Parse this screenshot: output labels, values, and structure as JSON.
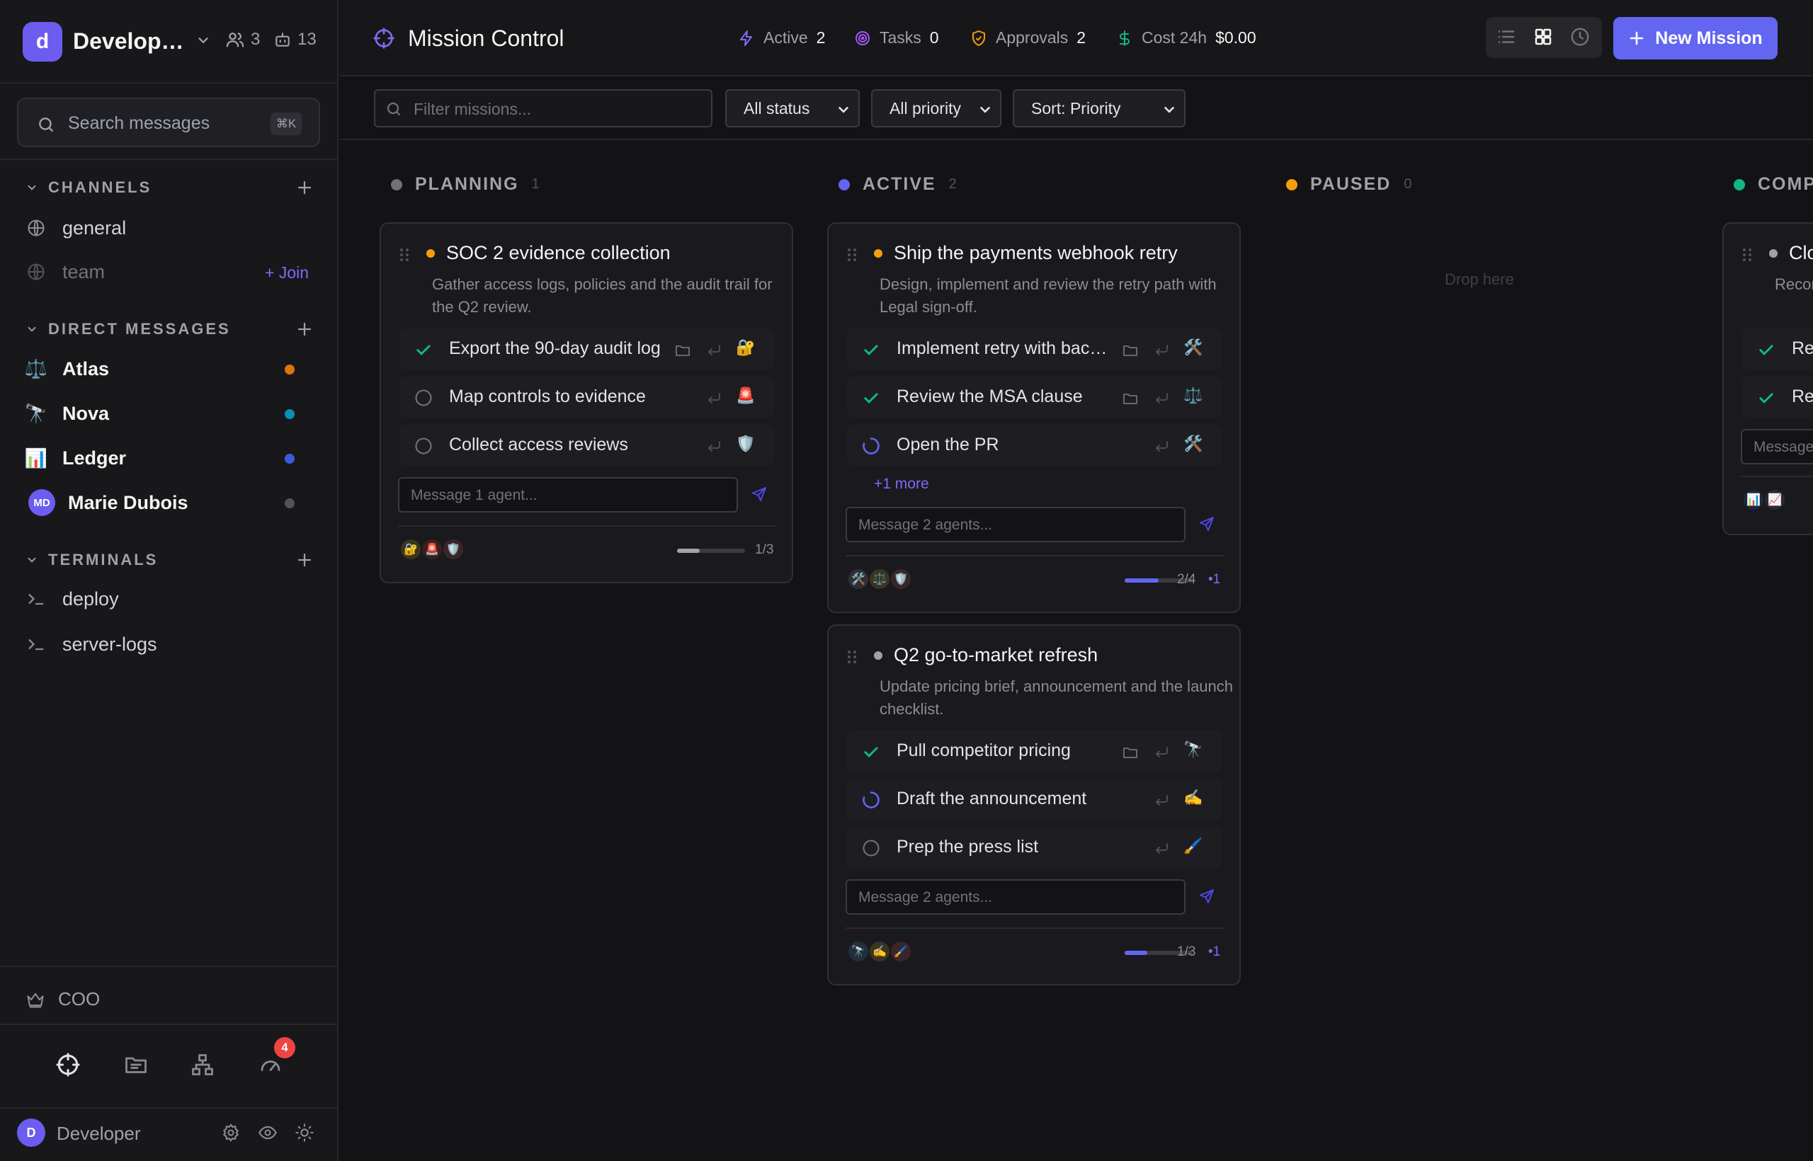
{
  "workspace": {
    "initial": "d",
    "name": "Development",
    "members": "3",
    "agents": "13"
  },
  "search": {
    "placeholder": "Search messages",
    "shortcut": "⌘K"
  },
  "channels": {
    "title": "CHANNELS",
    "items": [
      {
        "label": "general",
        "joined": true
      },
      {
        "label": "team",
        "joined": false,
        "join_label": "+ Join"
      }
    ]
  },
  "direct_messages": {
    "title": "DIRECT MESSAGES",
    "items": [
      {
        "label": "Atlas",
        "icon": "⚖️",
        "status_color": "#d97706"
      },
      {
        "label": "Nova",
        "icon": "🔭",
        "status_color": "#0891b2"
      },
      {
        "label": "Ledger",
        "icon": "📊",
        "status_color": "#3b5bdb"
      },
      {
        "label": "Marie Dubois",
        "initials": "MD",
        "status_color": "#52525b"
      }
    ]
  },
  "terminals": {
    "title": "TERMINALS",
    "items": [
      {
        "label": "deploy"
      },
      {
        "label": "server-logs"
      }
    ]
  },
  "coo": {
    "label": "COO"
  },
  "bottom_tabs": {
    "notifications_count": "4"
  },
  "user": {
    "initial": "D",
    "name": "Developer"
  },
  "header": {
    "title": "Mission Control",
    "stats": [
      {
        "label": "Active",
        "value": "2"
      },
      {
        "label": "Tasks",
        "value": "0"
      },
      {
        "label": "Approvals",
        "value": "2"
      },
      {
        "label": "Cost 24h",
        "value": "$0.00"
      }
    ],
    "new_mission_label": "New Mission"
  },
  "filters": {
    "search_placeholder": "Filter missions...",
    "status": "All status",
    "priority": "All priority",
    "sort": "Sort: Priority"
  },
  "columns": [
    {
      "name": "PLANNING",
      "count": "1",
      "color": "#71717a"
    },
    {
      "name": "ACTIVE",
      "count": "2",
      "color": "#6366f1"
    },
    {
      "name": "PAUSED",
      "count": "0",
      "color": "#f59e0b",
      "empty_label": "Drop here"
    },
    {
      "name": "COMPLETED",
      "count": "",
      "color": "#10b981"
    }
  ],
  "cards": [
    {
      "title": "SOC 2 evidence collection",
      "priority_color": "#f59e0b",
      "description": "Gather access logs, policies and the audit trail for the Q2 review.",
      "tasks": [
        {
          "label": "Export the 90-day audit log",
          "status": "done",
          "agent": "🔐"
        },
        {
          "label": "Map controls to evidence",
          "status": "todo",
          "agent": "🚨"
        },
        {
          "label": "Collect access reviews",
          "status": "todo",
          "agent": "🛡️"
        }
      ],
      "message_placeholder": "Message 1 agent...",
      "agents": [
        "🔐",
        "🚨",
        "🛡️"
      ],
      "progress": 0.33,
      "progress_label": "1/3"
    },
    {
      "title": "Ship the payments webhook retry",
      "priority_color": "#f59e0b",
      "description": "Design, implement and review the retry path with Legal sign-off.",
      "tasks": [
        {
          "label": "Implement retry with backoff",
          "status": "done",
          "agent": "🛠️"
        },
        {
          "label": "Review the MSA clause",
          "status": "done",
          "agent": "⚖️"
        },
        {
          "label": "Open the PR",
          "status": "running",
          "agent": "🛠️"
        }
      ],
      "more_label": "+1 more",
      "message_placeholder": "Message 2 agents...",
      "agents": [
        "🛠️",
        "⚖️",
        "🛡️"
      ],
      "progress": 0.5,
      "progress_label": "2/4",
      "new_label": "•1"
    },
    {
      "title": "Q2 go-to-market refresh",
      "priority_color": "#a1a1aa",
      "description": "Update pricing brief, announcement and the launch checklist.",
      "tasks": [
        {
          "label": "Pull competitor pricing",
          "status": "done",
          "agent": "🔭"
        },
        {
          "label": "Draft the announcement",
          "status": "running",
          "agent": "✍️"
        },
        {
          "label": "Prep the press list",
          "status": "todo",
          "agent": "🖌️"
        }
      ],
      "message_placeholder": "Message 2 agents...",
      "agents": [
        "🔭",
        "✍️",
        "🖌️"
      ],
      "progress": 0.33,
      "progress_label": "1/3",
      "new_label": "•1"
    },
    {
      "title": "Close the refund backlog",
      "priority_color": "#a1a1aa",
      "description": "Reconcile refunds",
      "tasks": [
        {
          "label": "Reconcile refunds",
          "status": "done"
        },
        {
          "label": "Report the refunds",
          "status": "done"
        }
      ],
      "message_placeholder": "Message",
      "agents": [
        "📊",
        "📈"
      ]
    }
  ],
  "colors": {
    "accent": "#6366f1",
    "done": "#10b981",
    "danger": "#ef4444"
  }
}
